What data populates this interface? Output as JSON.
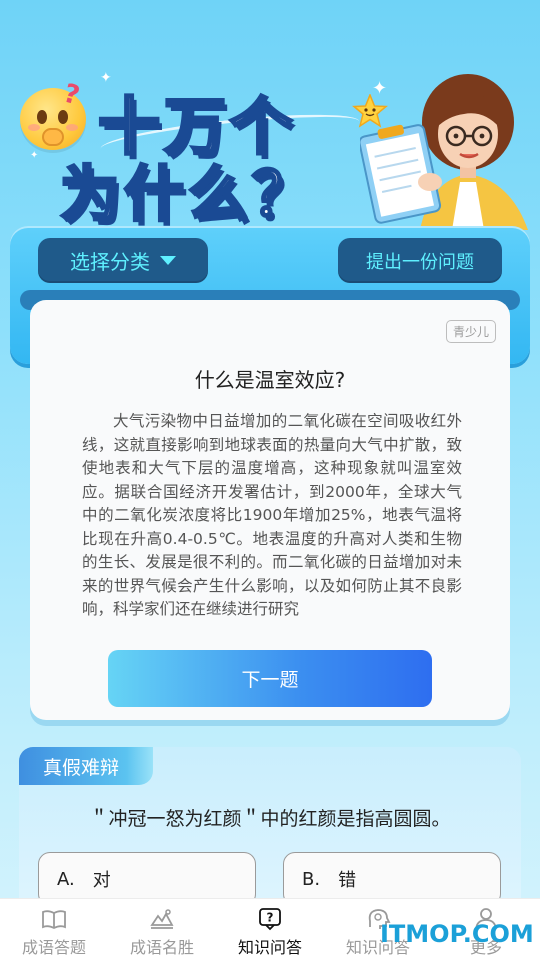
{
  "banner": {
    "title_line1": "十万个",
    "title_line2": "为什么？"
  },
  "header_buttons": {
    "category_label": "选择分类",
    "ask_label": "提出一份问题"
  },
  "question_card": {
    "badge": "青少儿",
    "title": "什么是温室效应?",
    "answer": "大气污染物中日益增加的二氧化碳在空间吸收红外线，这就直接影响到地球表面的热量向大气中扩散，致使地表和大气下层的温度增高，这种现象就叫温室效应。据联合国经济开发署估计，到2000年，全球大气中的二氧化炭浓度将比1900年增加25%，地表气温将比现在升高0.4-0.5℃。地表温度的升高对人类和生物的生长、发展是很不利的。而二氧化碳的日益增加对未来的世界气候会产生什么影响，以及如何防止其不良影响，科学家们还在继续进行研究",
    "next_label": "下一题"
  },
  "true_false": {
    "tag": "真假难辩",
    "question": "＂冲冠一怒为红颜＂中的红颜是指高圆圆。",
    "options": [
      {
        "letter": "A.",
        "text": "对"
      },
      {
        "letter": "B.",
        "text": "错"
      }
    ]
  },
  "bottom_nav": {
    "items": [
      {
        "label": "成语答题",
        "icon": "book-icon",
        "active": false
      },
      {
        "label": "成语名胜",
        "icon": "landmark-icon",
        "active": false
      },
      {
        "label": "知识问答",
        "icon": "question-bubble-icon",
        "active": true
      },
      {
        "label": "知识问答",
        "icon": "brain-head-icon",
        "active": false
      },
      {
        "label": "更多",
        "icon": "person-icon",
        "active": false
      }
    ]
  },
  "watermark": "ITMOP.COM",
  "colors": {
    "pill_bg": "#1f5a8a",
    "pill_text": "#5ff0ff",
    "accent_blue": "#3b8ef0",
    "panel_blue": "#33b7f2"
  }
}
